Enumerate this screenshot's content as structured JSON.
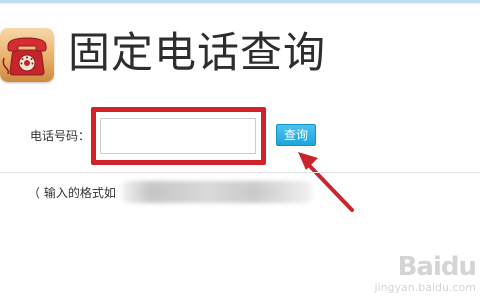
{
  "header": {
    "title": "固定电话查询"
  },
  "form": {
    "phone_label": "电话号码：",
    "phone_value": "",
    "query_button_label": "查询"
  },
  "hint": {
    "format_text": "（ 输入的格式如"
  },
  "watermark": {
    "brand": "Baidu",
    "domain": "jingyan.baidu.com"
  },
  "colors": {
    "highlight": "#d3232a",
    "button": "#1fa3de",
    "arrow": "#c8262c"
  },
  "icons": {
    "app": "telephone-icon",
    "annotation": "arrow-icon"
  }
}
